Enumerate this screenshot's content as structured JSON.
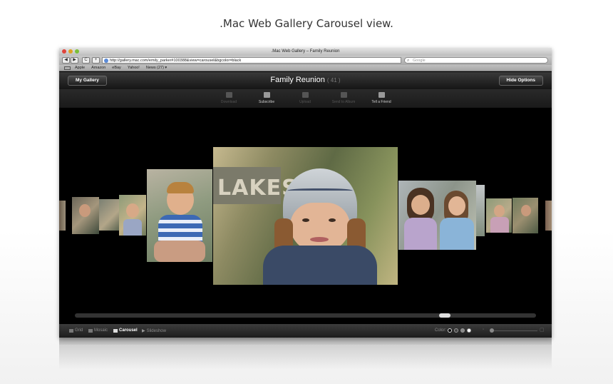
{
  "caption": ".Mac Web Gallery Carousel view.",
  "window": {
    "title": ".Mac Web Gallery – Family Reunion",
    "url": "http://gallery.mac.com/emily_parker#100388&view=carousel&bgcolor=black",
    "search_placeholder": "Google",
    "nav": {
      "back": "◀",
      "forward": "▶",
      "reload": "C",
      "add": "+"
    }
  },
  "bookmarks": [
    "Apple",
    "Amazon",
    "eBay",
    "Yahoo!",
    "News (27) ▾"
  ],
  "gallery": {
    "my_gallery_label": "My Gallery",
    "title": "Family Reunion",
    "count": "( 41 )",
    "hide_options_label": "Hide Options"
  },
  "actions": [
    {
      "label": "Download",
      "icon": "download-icon",
      "active": false
    },
    {
      "label": "Subscribe",
      "icon": "subscribe-icon",
      "active": true
    },
    {
      "label": "Upload",
      "icon": "upload-icon",
      "active": false
    },
    {
      "label": "Send to Album",
      "icon": "send-icon",
      "active": false
    },
    {
      "label": "Tell a Friend",
      "icon": "mail-icon",
      "active": true
    }
  ],
  "carousel": {
    "scroll_position": 0.81
  },
  "bottom_bar": {
    "views": [
      {
        "label": "Grid",
        "icon": "grid-icon",
        "active": false
      },
      {
        "label": "Mosaic",
        "icon": "mosaic-icon",
        "active": false
      },
      {
        "label": "Carousel",
        "icon": "carousel-icon",
        "active": true
      },
      {
        "label": "Slideshow",
        "icon": "slideshow-icon",
        "active": false
      }
    ],
    "apple_glyph": "",
    "color_label": "Color:",
    "colors": [
      "#000000",
      "#444444",
      "#888888",
      "#ffffff"
    ]
  },
  "colors": {
    "accent": "#ffffff",
    "background": "#000000"
  }
}
